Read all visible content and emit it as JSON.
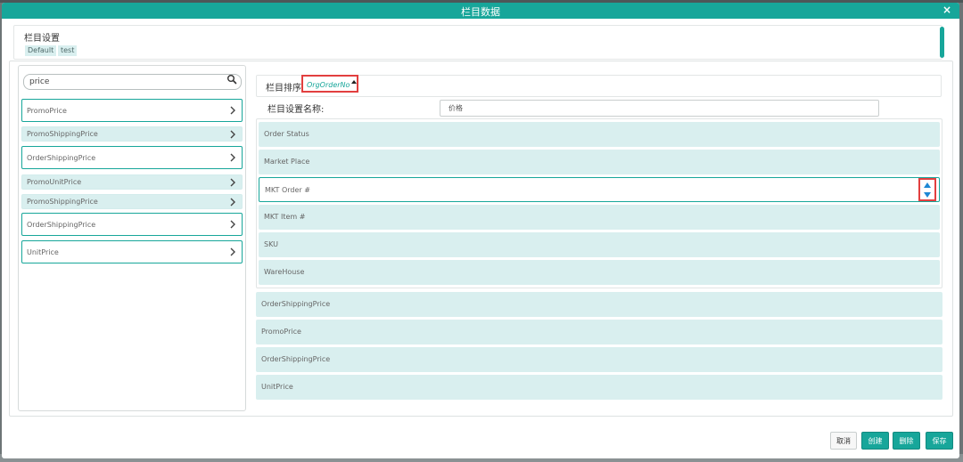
{
  "modal": {
    "title": "栏目数据",
    "close_label": "×"
  },
  "settings": {
    "title": "栏目设置",
    "chips": [
      "Default",
      "test"
    ]
  },
  "search": {
    "value": "price"
  },
  "available_fields": [
    "PromoPrice",
    "PromoShippingPrice",
    "OrderShippingPrice",
    "PromoUnitPrice",
    "PromoShippingPrice",
    "OrderShippingPrice",
    "UnitPrice"
  ],
  "sort": {
    "label": "栏目排序",
    "value": "OrgOrderNo"
  },
  "name": {
    "label": "栏目设置名称:",
    "value": "价格"
  },
  "columns": [
    "Order Status",
    "Market Place",
    "MKT Order #",
    "MKT Item #",
    "SKU",
    "WareHouse"
  ],
  "selected_columns": [
    "OrderShippingPrice",
    "PromoPrice",
    "OrderShippingPrice",
    "UnitPrice"
  ],
  "footer": {
    "cancel": "取消",
    "create": "创建",
    "delete": "删除",
    "save": "保存"
  },
  "colors": {
    "accent": "#17a69a",
    "highlight": "#e23f3f",
    "item_bg": "#d9efef"
  },
  "icons": [
    "search-icon",
    "close-icon",
    "chevron-right-icon",
    "caret-up-icon",
    "move-up-icon",
    "move-down-icon"
  ]
}
